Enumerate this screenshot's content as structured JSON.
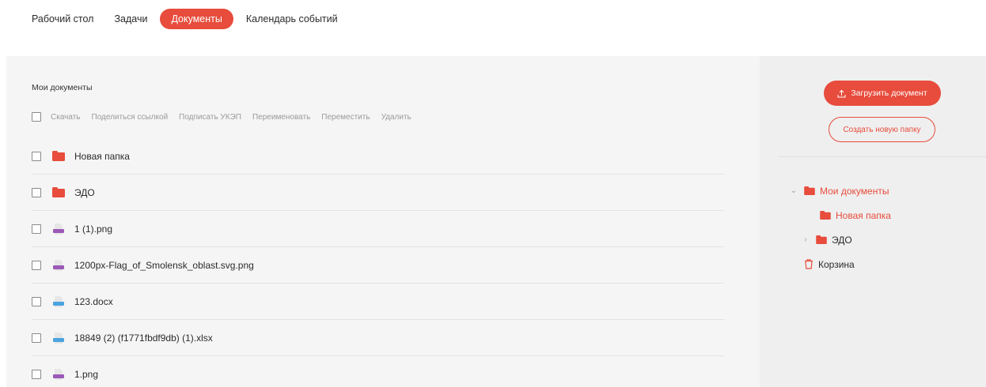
{
  "nav": {
    "tabs": [
      {
        "label": "Рабочий стол",
        "active": false
      },
      {
        "label": "Задачи",
        "active": false
      },
      {
        "label": "Документы",
        "active": true
      },
      {
        "label": "Календарь событий",
        "active": false
      }
    ]
  },
  "main": {
    "title": "Мои документы",
    "actions": [
      "Скачать",
      "Поделиться ссылкой",
      "Подписать УКЭП",
      "Переименовать",
      "Переместить",
      "Удалить"
    ],
    "rows": [
      {
        "name": "Новая папка",
        "icon": "folder-icon"
      },
      {
        "name": "ЭДО",
        "icon": "folder-icon"
      },
      {
        "name": "1 (1).png",
        "icon": "png-file-icon"
      },
      {
        "name": "1200px-Flag_of_Smolensk_oblast.svg.png",
        "icon": "png-file-icon"
      },
      {
        "name": "123.docx",
        "icon": "docx-file-icon"
      },
      {
        "name": "18849 (2) (f1771fbdf9db) (1).xlsx",
        "icon": "xlsx-file-icon"
      },
      {
        "name": "1.png",
        "icon": "png-file-icon"
      }
    ]
  },
  "side": {
    "upload_label": "Загрузить документ",
    "new_folder_label": "Создать новую папку",
    "tree": {
      "root": "Мои документы",
      "child1": "Новая папка",
      "child2": "ЭДО",
      "trash": "Корзина"
    }
  },
  "colors": {
    "accent": "#e74c3c",
    "png_icon": "#9b59b6",
    "docx_icon": "#4aa3df",
    "xlsx_icon": "#4aa3df"
  }
}
